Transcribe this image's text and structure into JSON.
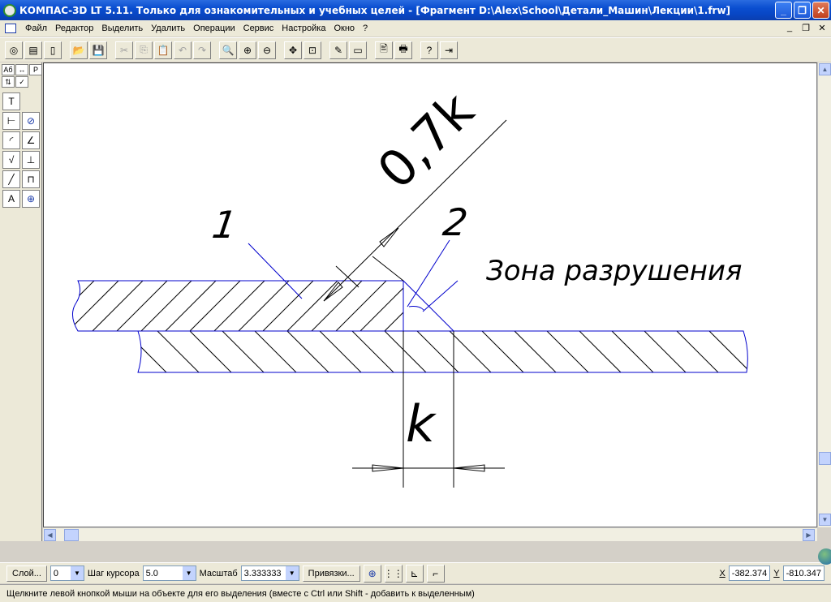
{
  "window": {
    "title": "КОМПАС-3D LT 5.11. Только для ознакомительных и учебных целей - [Фрагмент D:\\Alex\\School\\Детали_Машин\\Лекции\\1.frw]",
    "buttons": [
      "minimize",
      "maximize",
      "close"
    ]
  },
  "menu": {
    "items": [
      "Файл",
      "Редактор",
      "Выделить",
      "Удалить",
      "Операции",
      "Сервис",
      "Настройка",
      "Окно",
      "?"
    ]
  },
  "toolbar": {
    "icons": [
      "new-fragment-icon",
      "new-sheet-icon",
      "new-document-icon",
      "open-icon",
      "save-icon",
      "cut-icon",
      "copy-icon",
      "paste-icon",
      "undo-icon",
      "redo-icon",
      "zoom-icon",
      "zoom-in-icon",
      "zoom-out-icon",
      "pan-icon",
      "zoom-all-icon",
      "pencil-icon",
      "layer-icon",
      "preview-icon",
      "print-icon",
      "help-icon",
      "exit-icon"
    ]
  },
  "left_panel": {
    "tabs": [
      "Аб",
      "↔",
      "Р",
      "⇅",
      "✓"
    ],
    "tools": [
      "text-icon",
      "linear-dimension-icon",
      "diameter-dimension-icon",
      "radius-dimension-icon",
      "angle-dimension-icon",
      "roughness-icon",
      "base-icon",
      "leader-icon",
      "form-tolerance-icon",
      "label-icon",
      "center-icon"
    ]
  },
  "drawing": {
    "label_1": "1",
    "label_2": "2",
    "label_07k": "0,7k",
    "label_zone": "Зона разрушения",
    "label_k": "k",
    "line_color": "#0000cc",
    "stroke_color": "#000000"
  },
  "status": {
    "layer_button": "Слой...",
    "layer_value": "0",
    "step_label": "Шаг курсора",
    "step_value": "5.0",
    "scale_label": "Масштаб",
    "scale_value": "3.333333",
    "snap_button": "Привязки...",
    "x_label": "X",
    "x_value": "-382.374",
    "y_label": "Y",
    "y_value": "-810.347"
  },
  "hint": {
    "text": "Щелкните левой кнопкой мыши на объекте для его выделения (вместе с Ctrl или Shift - добавить к выделенным)"
  }
}
